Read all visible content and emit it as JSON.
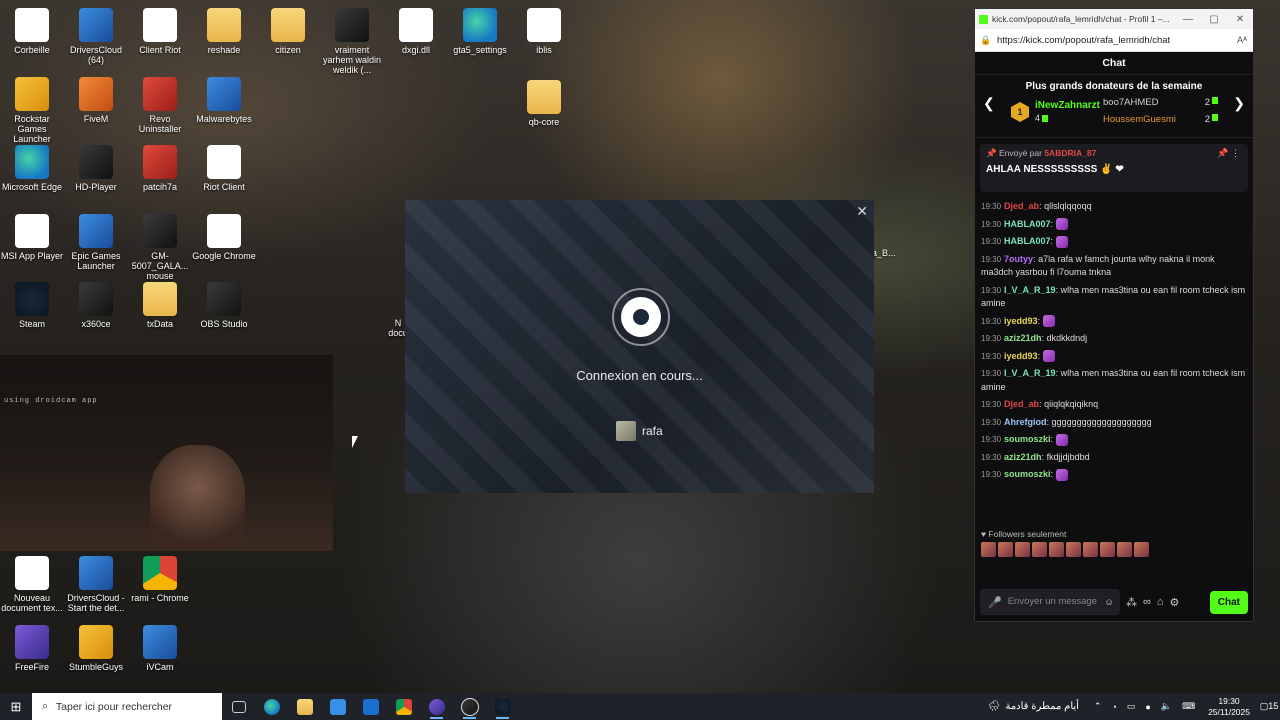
{
  "desktop": {
    "icons": [
      {
        "label": "Corbeille",
        "name": "recycle-bin-icon"
      },
      {
        "label": "DriversCloud (64)",
        "name": "driverscloud-icon"
      },
      {
        "label": "Client Riot",
        "name": "file-icon"
      },
      {
        "label": "reshade",
        "name": "folder-icon"
      },
      {
        "label": "citizen",
        "name": "folder-icon"
      },
      {
        "label": "vraiment yarhem waldin weldik (...",
        "name": "video-icon"
      },
      {
        "label": "dxgi.dll",
        "name": "dll-file-icon"
      },
      {
        "label": "gta5_settings",
        "name": "edge-file-icon"
      },
      {
        "label": "iblis",
        "name": "image-file-icon"
      },
      {
        "label": "Rockstar Games Launcher",
        "name": "rockstar-icon"
      },
      {
        "label": "FiveM",
        "name": "fivem-icon"
      },
      {
        "label": "Revo Uninstaller",
        "name": "revo-icon"
      },
      {
        "label": "Malwarebytes",
        "name": "malwarebytes-icon"
      },
      {
        "label": "qb-core",
        "name": "folder-icon"
      },
      {
        "label": "Microsoft Edge",
        "name": "edge-icon"
      },
      {
        "label": "HD-Player",
        "name": "hdplayer-icon"
      },
      {
        "label": "patcih7a",
        "name": "winrar-icon"
      },
      {
        "label": "Riot Client",
        "name": "file-icon"
      },
      {
        "label": "MSI App Player",
        "name": "file-icon"
      },
      {
        "label": "Epic Games Launcher",
        "name": "epic-icon"
      },
      {
        "label": "GM-5007_GALA... mouse",
        "name": "mouse-app-icon"
      },
      {
        "label": "Google Chrome",
        "name": "file-icon"
      },
      {
        "label": "Steam",
        "name": "steam-icon"
      },
      {
        "label": "x360ce",
        "name": "gamepad-icon"
      },
      {
        "label": "txData",
        "name": "folder-icon"
      },
      {
        "label": "OBS Studio",
        "name": "obs-icon"
      },
      {
        "label": "Nouveau document tex...",
        "name": "text-file-icon"
      },
      {
        "label": "DriversCloud - Start the det...",
        "name": "driverscloud-shortcut-icon"
      },
      {
        "label": "rami - Chrome",
        "name": "chrome-icon"
      },
      {
        "label": "FreeFire",
        "name": "freefire-icon"
      },
      {
        "label": "StumbleGuys",
        "name": "stumbleguys-icon"
      },
      {
        "label": "iVCam",
        "name": "ivcam-icon"
      }
    ],
    "partial_labels": {
      "n_docu": "N docu",
      "a_b": "a_B..."
    }
  },
  "camera": {
    "watermark": "using droidcam app"
  },
  "steam_dialog": {
    "status": "Connexion en cours...",
    "username": "rafa",
    "close_glyph": "✕"
  },
  "browser": {
    "title": "kick.com/popout/rafa_lemridh/chat - Profil 1 –...",
    "url": "https://kick.com/popout/rafa_lemridh/chat",
    "controls": {
      "minimize": "—",
      "maximize": "▢",
      "close": "✕"
    },
    "chat_header": "Chat",
    "donators": {
      "title": "Plus grands donateurs de la semaine",
      "first": {
        "rank": "1",
        "name": "iNewZahnarzt",
        "count": "4"
      },
      "others": [
        {
          "name": "boo7AHMED",
          "count": "2",
          "color": "#cfcfcf"
        },
        {
          "name": "HoussemGuesmi",
          "count": "2",
          "color": "#e39a3b"
        }
      ]
    },
    "pinned": {
      "prefix": "Envoyé par",
      "user": "5ABDRIA_87",
      "text": "AHLAA NESSSSSSSSS ✌ ❤"
    },
    "messages": [
      {
        "time": "19:30",
        "user": "Djed_ab",
        "color": "#e04848",
        "text": "qllslqlqqoqq",
        "emote": false
      },
      {
        "time": "19:30",
        "user": "HABLA007",
        "color": "#7be3c3",
        "text": "",
        "emote": true
      },
      {
        "time": "19:30",
        "user": "HABLA007",
        "color": "#7be3c3",
        "text": "",
        "emote": true
      },
      {
        "time": "19:30",
        "user": "7outyy",
        "color": "#b36cf0",
        "text": "a7la rafa w famch jounta wlhy nakna il monk ma3dch yasrbou fi l7ouma tnkna",
        "emote": false
      },
      {
        "time": "19:30",
        "user": "I_V_A_R_19",
        "color": "#7be3c3",
        "text": "wlha men mas3tina ou ean fil room tcheck ism amine",
        "emote": false
      },
      {
        "time": "19:30",
        "user": "iyedd93",
        "color": "#e7d45a",
        "text": "",
        "emote": true
      },
      {
        "time": "19:30",
        "user": "aziz21dh",
        "color": "#8fe38a",
        "text": "dkdkkdndj",
        "emote": false
      },
      {
        "time": "19:30",
        "user": "iyedd93",
        "color": "#e7d45a",
        "text": "",
        "emote": true
      },
      {
        "time": "19:30",
        "user": "I_V_A_R_19",
        "color": "#7be3c3",
        "text": "wlha men mas3tina ou ean fil room tcheck ism amine",
        "emote": false
      },
      {
        "time": "19:30",
        "user": "Djed_ab",
        "color": "#e04848",
        "text": "qiiqlqkqiqiknq",
        "emote": false
      },
      {
        "time": "19:30",
        "user": "Ahrefgiod",
        "color": "#9ec3f5",
        "text": "gggggggggggggggggggg",
        "emote": false
      },
      {
        "time": "19:30",
        "user": "soumoszki",
        "color": "#8fe38a",
        "text": "",
        "emote": true
      },
      {
        "time": "19:30",
        "user": "aziz21dh",
        "color": "#8fe38a",
        "text": "fkdjjdjbdbd",
        "emote": false
      },
      {
        "time": "19:30",
        "user": "soumoszki",
        "color": "#8fe38a",
        "text": "",
        "emote": true
      }
    ],
    "followers_only": "Followers seulement",
    "input_placeholder": "Envoyer un message",
    "send_label": "Chat"
  },
  "taskbar": {
    "search_placeholder": "Taper ici pour rechercher",
    "weather_text": "أيام ممطرة قادمة",
    "time": "19:30",
    "date": "25/11/2025",
    "notification_count": "15"
  },
  "colors": {
    "kick_green": "#53fc18",
    "taskbar": "#1f2329"
  }
}
